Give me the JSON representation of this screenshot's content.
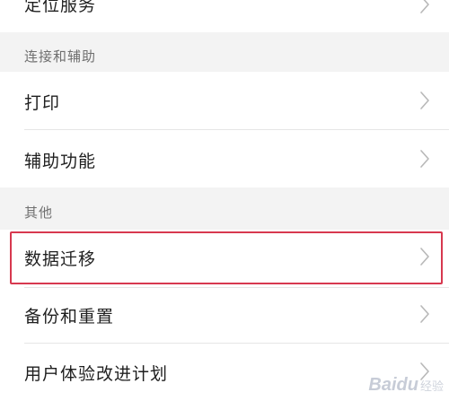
{
  "settings": {
    "items": [
      {
        "label": "定位服务"
      },
      {
        "label": "打印"
      },
      {
        "label": "辅助功能"
      },
      {
        "label": "数据迁移"
      },
      {
        "label": "备份和重置"
      },
      {
        "label": "用户体验改进计划"
      }
    ],
    "sections": [
      {
        "label": "连接和辅助"
      },
      {
        "label": "其他"
      }
    ]
  },
  "annotation": {
    "highlighted_item": "数据迁移",
    "color": "#d7384f"
  },
  "watermark": {
    "brand": "Baidu",
    "suffix": "经验"
  },
  "icons": {
    "chevron": "chevron-right-icon"
  }
}
